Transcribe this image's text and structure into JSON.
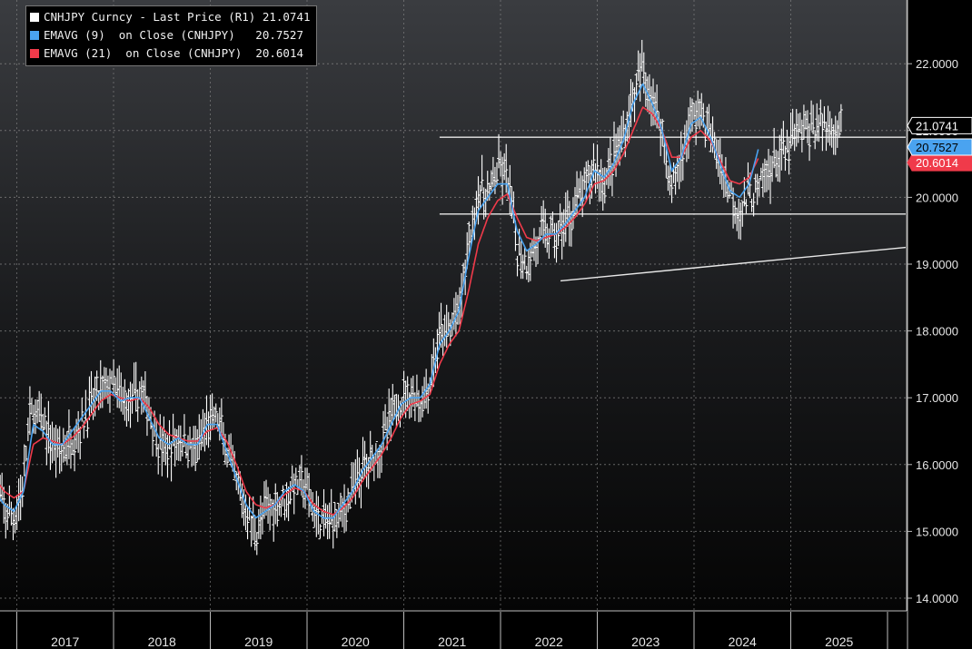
{
  "legend": {
    "items": [
      {
        "label": "CNHJPY Curncy - Last Price (R1)",
        "value": "21.0741",
        "color": "#ffffff"
      },
      {
        "label": "EMAVG (9)  on Close (CNHJPY)",
        "value": "20.7527",
        "color": "#4aa3f0"
      },
      {
        "label": "EMAVG (21)  on Close (CNHJPY)",
        "value": "20.6014",
        "color": "#f03a4a"
      }
    ]
  },
  "badges": {
    "price": "21.0741",
    "ema9": "20.7527",
    "ema21": "20.6014"
  },
  "chart_data": {
    "type": "line",
    "title": "",
    "xlabel": "",
    "ylabel": "",
    "x_ticks": [
      "2017",
      "2018",
      "2019",
      "2020",
      "2021",
      "2022",
      "2023",
      "2024",
      "2025"
    ],
    "y_ticks": [
      "14.0000",
      "15.0000",
      "16.0000",
      "17.0000",
      "18.0000",
      "19.0000",
      "20.0000",
      "21.0000",
      "22.0000"
    ],
    "ylim": [
      13.75,
      23.0
    ],
    "xlim": [
      2016.65,
      2025.55
    ],
    "grid": true,
    "legend_position": "top-left",
    "colors": {
      "price": "#ffffff",
      "ema9": "#4aa3f0",
      "ema21": "#f03a4a",
      "lines": "#e8e8e8"
    },
    "series": [
      {
        "name": "CNHJPY Curncy - Last Price (R1)",
        "style": "weekly bars",
        "x": [
          2016.65,
          2016.75,
          2016.85,
          2016.95,
          2017.0,
          2017.05,
          2017.15,
          2017.25,
          2017.35,
          2017.45,
          2017.55,
          2017.65,
          2017.75,
          2017.85,
          2017.95,
          2018.05,
          2018.15,
          2018.25,
          2018.35,
          2018.45,
          2018.55,
          2018.65,
          2018.75,
          2018.85,
          2018.95,
          2019.05,
          2019.15,
          2019.25,
          2019.35,
          2019.45,
          2019.55,
          2019.65,
          2019.75,
          2019.85,
          2019.95,
          2020.05,
          2020.15,
          2020.25,
          2020.35,
          2020.45,
          2020.55,
          2020.65,
          2020.75,
          2020.85,
          2020.95,
          2021.05,
          2021.15,
          2021.25,
          2021.35,
          2021.45,
          2021.55,
          2021.65,
          2021.75,
          2021.85,
          2021.95,
          2022.05,
          2022.15,
          2022.25,
          2022.35,
          2022.45,
          2022.55,
          2022.65,
          2022.75,
          2022.85,
          2022.95,
          2023.05,
          2023.15,
          2023.25,
          2023.35,
          2023.45,
          2023.55,
          2023.65,
          2023.75,
          2023.85,
          2023.95,
          2024.05,
          2024.15,
          2024.25,
          2024.35,
          2024.45,
          2024.55,
          2024.65,
          2024.75,
          2024.85,
          2024.95,
          2025.05,
          2025.15,
          2025.25,
          2025.35,
          2025.4
        ],
        "values": [
          15.7,
          15.3,
          15.2,
          15.7,
          16.6,
          16.8,
          16.6,
          16.3,
          16.2,
          16.4,
          16.6,
          16.9,
          17.1,
          17.2,
          17.0,
          16.9,
          17.1,
          16.8,
          16.3,
          16.2,
          16.4,
          16.3,
          16.2,
          16.6,
          16.7,
          16.2,
          15.7,
          15.3,
          15.0,
          15.3,
          15.4,
          15.5,
          15.7,
          15.7,
          15.3,
          15.1,
          15.2,
          15.3,
          15.6,
          15.9,
          16.1,
          16.3,
          16.7,
          17.0,
          17.1,
          16.9,
          17.2,
          17.9,
          18.0,
          18.3,
          19.3,
          20.1,
          20.0,
          20.4,
          20.3,
          19.2,
          19.0,
          19.3,
          19.5,
          19.4,
          19.6,
          19.9,
          20.1,
          20.5,
          20.2,
          20.6,
          20.9,
          21.5,
          21.9,
          21.5,
          21.0,
          20.1,
          20.6,
          21.2,
          21.3,
          20.9,
          20.5,
          20.1,
          19.8,
          20.0,
          20.1,
          20.4,
          20.6,
          20.7,
          21.0,
          21.0,
          21.07,
          21.07,
          21.07,
          21.07
        ]
      },
      {
        "name": "EMAVG (9) on Close (CNHJPY)",
        "x": [
          2016.65,
          2016.75,
          2016.85,
          2016.95,
          2017.05,
          2017.15,
          2017.25,
          2017.35,
          2017.45,
          2017.55,
          2017.65,
          2017.75,
          2017.85,
          2017.95,
          2018.05,
          2018.15,
          2018.25,
          2018.35,
          2018.45,
          2018.55,
          2018.65,
          2018.75,
          2018.85,
          2018.95,
          2019.05,
          2019.15,
          2019.25,
          2019.35,
          2019.45,
          2019.55,
          2019.65,
          2019.75,
          2019.85,
          2019.95,
          2020.05,
          2020.15,
          2020.25,
          2020.35,
          2020.45,
          2020.55,
          2020.65,
          2020.75,
          2020.85,
          2020.95,
          2021.05,
          2021.15,
          2021.25,
          2021.35,
          2021.45,
          2021.55,
          2021.65,
          2021.75,
          2021.85,
          2021.95,
          2022.05,
          2022.15,
          2022.25,
          2022.35,
          2022.45,
          2022.55,
          2022.65,
          2022.75,
          2022.85,
          2022.95,
          2023.05,
          2023.15,
          2023.25,
          2023.35,
          2023.45,
          2023.55,
          2023.65,
          2023.75,
          2023.85,
          2023.95,
          2024.05,
          2024.15,
          2024.25,
          2024.35,
          2024.45,
          2024.55
        ],
        "values": [
          15.6,
          15.4,
          15.3,
          15.6,
          16.6,
          16.5,
          16.3,
          16.3,
          16.5,
          16.7,
          16.9,
          17.1,
          17.1,
          16.95,
          17.0,
          17.0,
          16.7,
          16.4,
          16.3,
          16.4,
          16.3,
          16.3,
          16.6,
          16.6,
          16.2,
          15.8,
          15.4,
          15.2,
          15.3,
          15.4,
          15.6,
          15.7,
          15.6,
          15.3,
          15.2,
          15.2,
          15.4,
          15.6,
          15.9,
          16.1,
          16.3,
          16.6,
          16.9,
          17.0,
          17.0,
          17.2,
          17.8,
          18.0,
          18.3,
          19.1,
          19.8,
          20.0,
          20.2,
          20.2,
          19.5,
          19.2,
          19.3,
          19.45,
          19.45,
          19.6,
          19.8,
          20.0,
          20.4,
          20.3,
          20.5,
          20.85,
          21.4,
          21.7,
          21.4,
          21.0,
          20.4,
          20.6,
          21.1,
          21.2,
          20.9,
          20.5,
          20.1,
          20.0,
          20.2,
          20.75
        ]
      },
      {
        "name": "EMAVG (21) on Close (CNHJPY)",
        "x": [
          2016.65,
          2016.75,
          2016.85,
          2016.95,
          2017.05,
          2017.15,
          2017.25,
          2017.35,
          2017.45,
          2017.55,
          2017.65,
          2017.75,
          2017.85,
          2017.95,
          2018.05,
          2018.15,
          2018.25,
          2018.35,
          2018.45,
          2018.55,
          2018.65,
          2018.75,
          2018.85,
          2018.95,
          2019.05,
          2019.15,
          2019.25,
          2019.35,
          2019.45,
          2019.55,
          2019.65,
          2019.75,
          2019.85,
          2019.95,
          2020.05,
          2020.15,
          2020.25,
          2020.35,
          2020.45,
          2020.55,
          2020.65,
          2020.75,
          2020.85,
          2020.95,
          2021.05,
          2021.15,
          2021.25,
          2021.35,
          2021.45,
          2021.55,
          2021.65,
          2021.75,
          2021.85,
          2021.95,
          2022.05,
          2022.15,
          2022.25,
          2022.35,
          2022.45,
          2022.55,
          2022.65,
          2022.75,
          2022.85,
          2022.95,
          2023.05,
          2023.15,
          2023.25,
          2023.35,
          2023.45,
          2023.55,
          2023.65,
          2023.75,
          2023.85,
          2023.95,
          2024.05,
          2024.15,
          2024.25,
          2024.35,
          2024.45,
          2024.55
        ],
        "values": [
          15.8,
          15.6,
          15.5,
          15.6,
          16.3,
          16.4,
          16.35,
          16.3,
          16.4,
          16.55,
          16.75,
          16.95,
          17.05,
          17.0,
          16.95,
          17.0,
          16.85,
          16.6,
          16.45,
          16.4,
          16.35,
          16.35,
          16.5,
          16.55,
          16.35,
          16.0,
          15.6,
          15.4,
          15.35,
          15.4,
          15.55,
          15.65,
          15.6,
          15.4,
          15.3,
          15.25,
          15.35,
          15.5,
          15.75,
          15.95,
          16.15,
          16.4,
          16.7,
          16.9,
          16.95,
          17.05,
          17.5,
          17.8,
          18.0,
          18.6,
          19.3,
          19.7,
          19.95,
          20.05,
          19.7,
          19.4,
          19.35,
          19.4,
          19.45,
          19.55,
          19.7,
          19.9,
          20.2,
          20.25,
          20.4,
          20.65,
          21.0,
          21.35,
          21.25,
          21.0,
          20.6,
          20.6,
          20.9,
          21.0,
          20.85,
          20.55,
          20.25,
          20.2,
          20.3,
          20.6
        ]
      }
    ],
    "reference_lines": [
      {
        "kind": "horizontal",
        "x_start": 2021.25,
        "x_end": 2025.55,
        "y": 20.9
      },
      {
        "kind": "horizontal",
        "x_start": 2021.25,
        "x_end": 2025.55,
        "y": 19.75
      },
      {
        "kind": "trend",
        "x_start": 2022.5,
        "y_start": 18.75,
        "x_end": 2025.55,
        "y_end": 19.25
      }
    ]
  }
}
